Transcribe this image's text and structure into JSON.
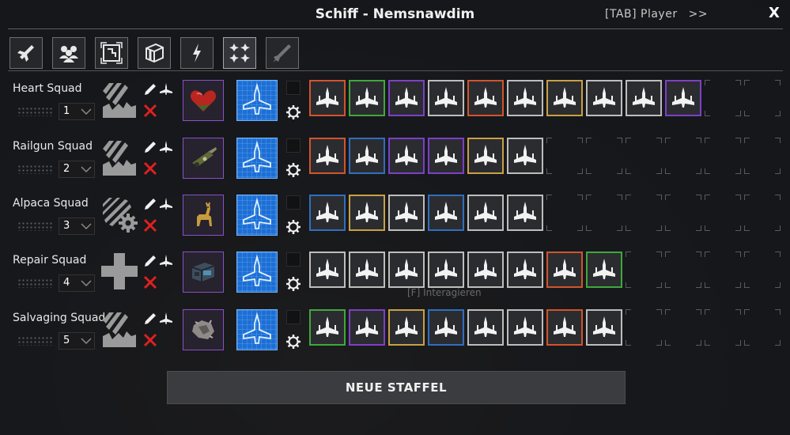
{
  "window": {
    "title": "Schiff - Nemsnawdim",
    "switch_label": "[TAB] Player",
    "switch_arrow": ">>",
    "close_label": "X"
  },
  "tabs": [
    {
      "icon": "ship-icon",
      "active": false
    },
    {
      "icon": "crew-icon",
      "active": false
    },
    {
      "icon": "blueprint-frame-icon",
      "active": false
    },
    {
      "icon": "cargo-box-icon",
      "active": false
    },
    {
      "icon": "lightning-icon",
      "active": false
    },
    {
      "icon": "squad-fighters-icon",
      "active": true
    },
    {
      "icon": "torpedo-icon",
      "active": false
    }
  ],
  "colors": {
    "orange": "#d2542c",
    "green": "#3fa83b",
    "purple": "#7d3fc7",
    "white": "#bdbdbd",
    "yellow": "#caa043",
    "blue": "#2f6fbf",
    "red": "#d81e1e",
    "blueprint": "#1c6fd6"
  },
  "squads": [
    {
      "name": "Heart Squad",
      "number": "1",
      "order_icon": "salvage-order-icon",
      "cargo_icon": "heart-cargo-icon",
      "fighters": [
        "orange",
        "green",
        "purple",
        "white",
        "orange",
        "white",
        "yellow",
        "white",
        "white",
        "purple"
      ]
    },
    {
      "name": "Railgun Squad",
      "number": "2",
      "order_icon": "salvage-order-icon",
      "cargo_icon": "railgun-cargo-icon",
      "fighters": [
        "orange",
        "blue",
        "purple",
        "purple",
        "yellow",
        "white"
      ]
    },
    {
      "name": "Alpaca Squad",
      "number": "3",
      "order_icon": "harvest-order-icon",
      "cargo_icon": "alpaca-cargo-icon",
      "fighters": [
        "blue",
        "yellow",
        "white",
        "blue",
        "white",
        "white"
      ]
    },
    {
      "name": "Repair Squad",
      "number": "4",
      "order_icon": "repair-order-icon",
      "cargo_icon": "repair-drone-cargo-icon",
      "fighters": [
        "white",
        "white",
        "white",
        "white",
        "white",
        "white",
        "orange",
        "green"
      ]
    },
    {
      "name": "Salvaging Squad",
      "number": "5",
      "order_icon": "salvage-order-icon",
      "cargo_icon": "salvage-cargo-icon",
      "fighters": [
        "green",
        "purple",
        "yellow",
        "blue",
        "white",
        "white",
        "orange",
        "white"
      ]
    }
  ],
  "slots_per_row": 12,
  "interact_hint": "[F] Interagieren",
  "new_squad_label": "NEUE STAFFEL"
}
